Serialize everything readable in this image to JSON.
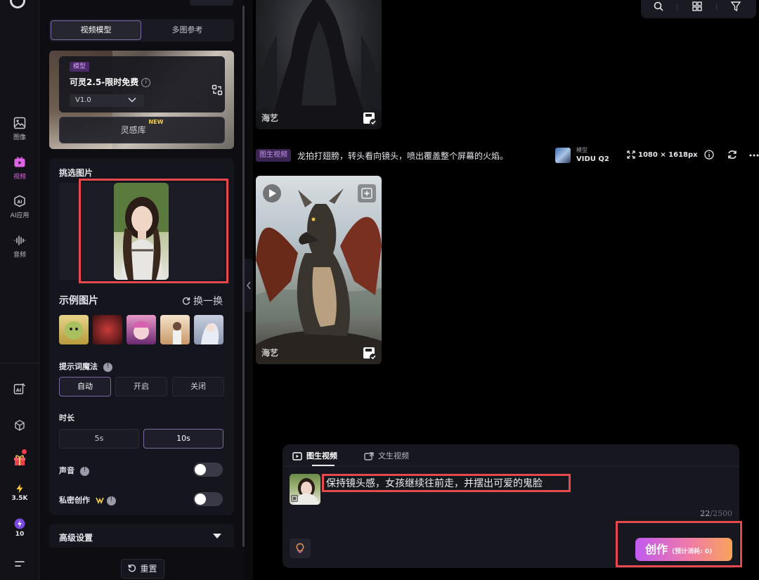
{
  "rail": {
    "items": [
      {
        "label": "图像",
        "icon": "image-icon"
      },
      {
        "label": "视频",
        "icon": "video-icon"
      },
      {
        "label": "AI应用",
        "icon": "ai-app-icon"
      },
      {
        "label": "音频",
        "icon": "audio-icon"
      }
    ],
    "energy_count": "3.5K",
    "bolt_count": "10"
  },
  "panel": {
    "tabs": [
      "视频模型",
      "多图参考"
    ],
    "model": {
      "tag": "模型",
      "name": "可灵2.5-限时免费",
      "version": "V1.0",
      "library": "灵感库",
      "library_badge": "NEW"
    },
    "pick_image_label": "挑选图片",
    "examples_label": "示例图片",
    "refresh_label": "换一换",
    "prompt_magic_label": "提示词魔法",
    "prompt_magic_options": [
      "自动",
      "开启",
      "关闭"
    ],
    "duration_label": "时长",
    "duration_options": [
      "5s",
      "10s"
    ],
    "sound_label": "声音",
    "private_label": "私密创作",
    "advanced_label": "高级设置",
    "reset_label": "重置"
  },
  "gallery": {
    "watermark": "海艺",
    "record": {
      "type_pill": "图生视频",
      "prompt": "龙拍打翅膀，转头看向镜头，喷出覆盖整个屏幕的火焰。",
      "model_label": "模型",
      "model_value": "VIDU Q2",
      "resolution": "1080 × 1618px"
    }
  },
  "composer": {
    "tabs": [
      "图生视频",
      "文生视频"
    ],
    "prompt": "保持镜头感，女孩继续往前走，并摆出可爱的鬼脸",
    "count": "22",
    "max": "/2500",
    "create_label": "创作",
    "cost_label": "(预计消耗: 0)"
  },
  "colors": {
    "accent": "#e062e6",
    "highlight": "#e5484d",
    "create_gradient_start": "#c05af0",
    "create_gradient_end": "#f7a35a"
  }
}
